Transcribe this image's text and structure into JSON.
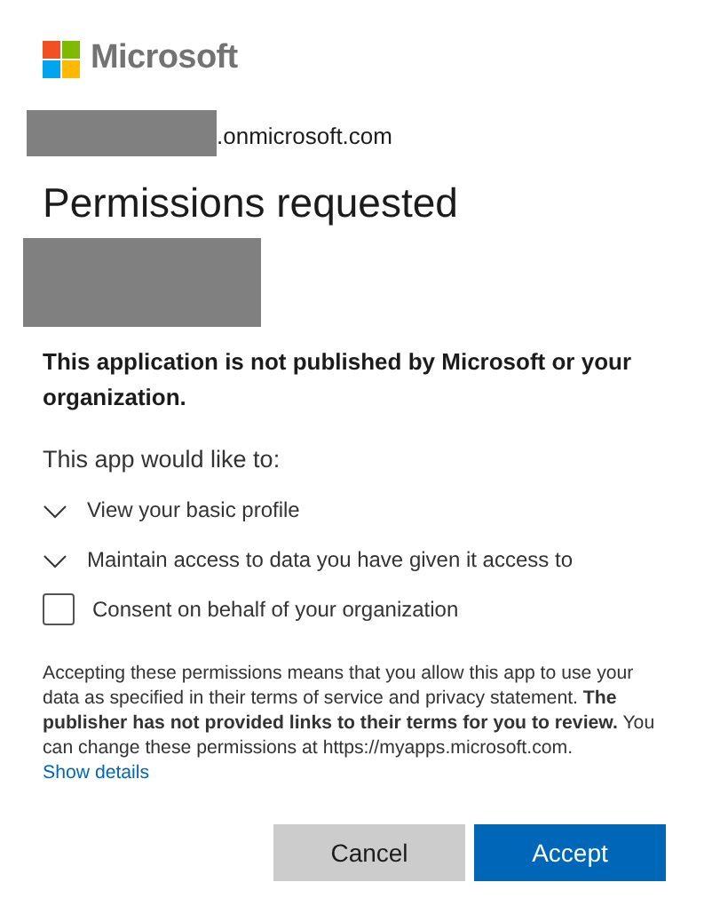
{
  "brand": {
    "name": "Microsoft"
  },
  "account": {
    "domain": ".onmicrosoft.com"
  },
  "title": "Permissions requested",
  "warning": "This application is not published by Microsoft or your organization.",
  "intro": "This app would like to:",
  "permissions": [
    {
      "label": "View your basic profile",
      "expanded": false
    },
    {
      "label": "Maintain access to data you have given it access to",
      "expanded": false
    }
  ],
  "consent": {
    "label": "Consent on behalf of your organization",
    "checked": false
  },
  "notice": {
    "text": "Accepting these permissions means that you allow this app to use your data as specified in their terms of service and privacy statement. **The publisher has not provided links to their terms for you to review.** You can change these permissions at https://myapps.microsoft.com.",
    "link": "Show details"
  },
  "buttons": [
    {
      "label": "Cancel",
      "kind": "secondary"
    },
    {
      "label": "Accept",
      "kind": "primary"
    }
  ]
}
